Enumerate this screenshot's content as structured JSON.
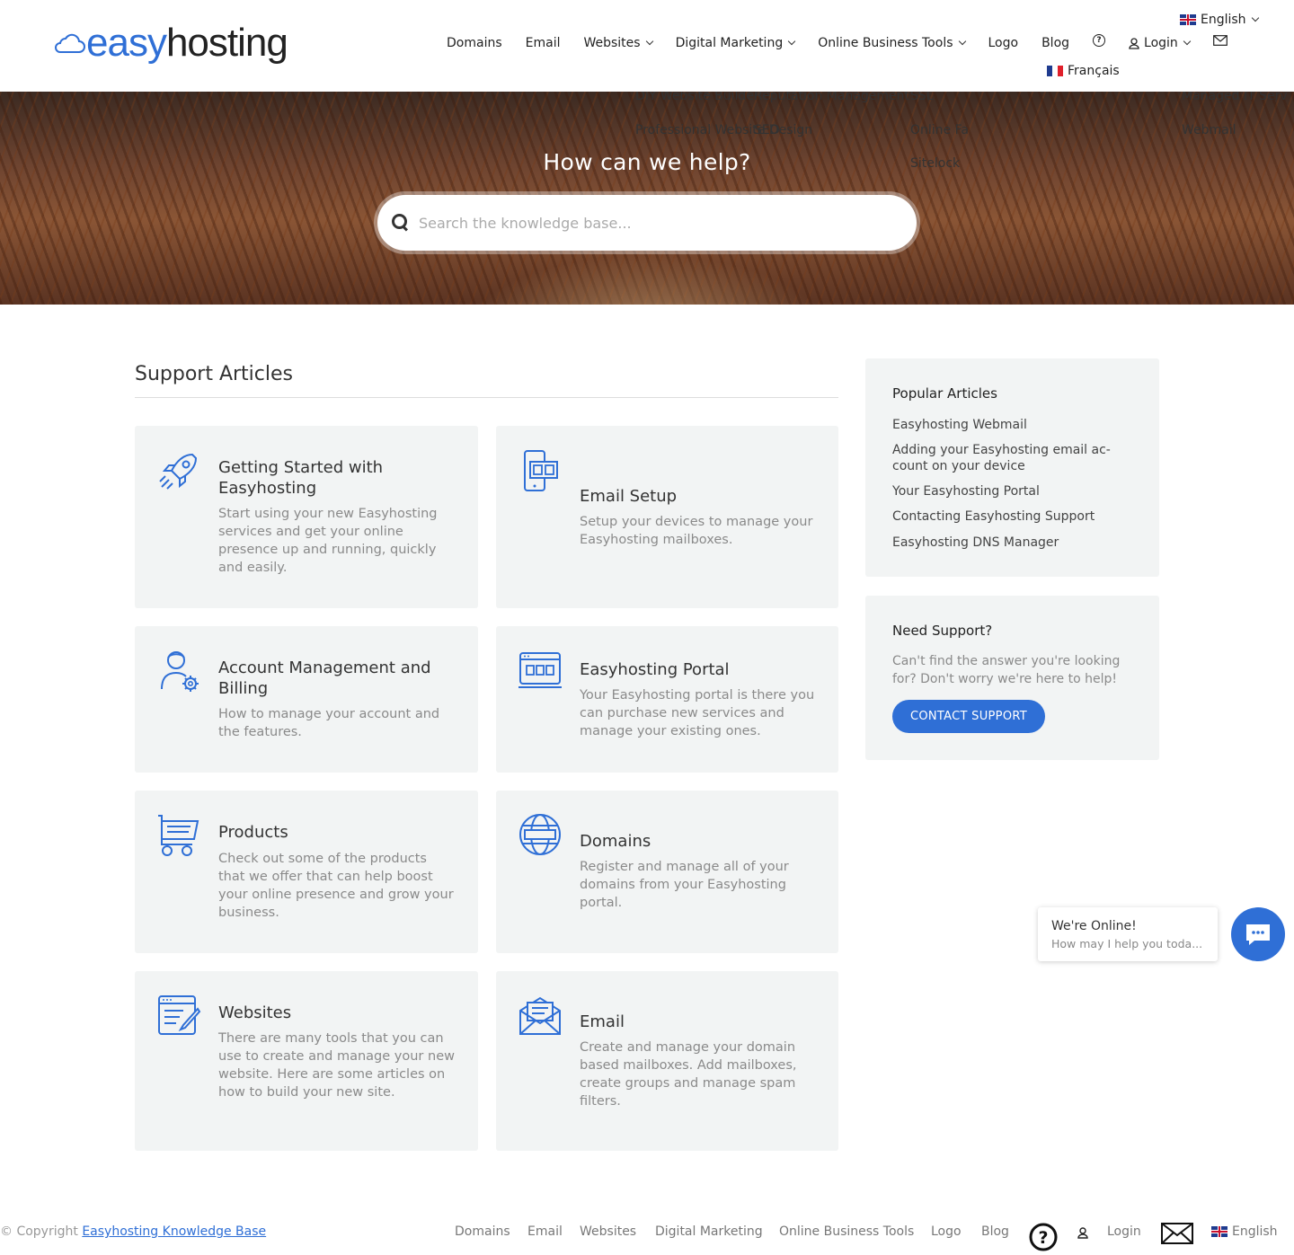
{
  "brand": {
    "logo_easy": "easy",
    "logo_hosting": "hosting",
    "accent_color": "#2f6fd6"
  },
  "nav": {
    "items": [
      "Domains",
      "Email",
      "Websites",
      "Digital Marketing",
      "Online Business Tools",
      "Logo",
      "Blog"
    ],
    "login": "Login",
    "lang_current": "English",
    "lang_alt": "Français"
  },
  "hero": {
    "title": "How can we help?",
    "search_placeholder": "Search the knowledge base...",
    "dropdown_ghost": {
      "diy": "DIY Website Builder",
      "pro": "Professional Website Design",
      "rep": "Reputation Management",
      "seo": "SEO",
      "ssl": "SSL",
      "online": "Online Fa",
      "sitelock": "Sitelock",
      "managed": "Managed IT Serv",
      "webmail": "Webmail"
    }
  },
  "main": {
    "section_title": "Support Articles",
    "cards": [
      {
        "title": "Getting Started with Easyhosting",
        "desc": "Start using your new Easyhosting services and get your online presence up and running, quickly and easily.",
        "icon": "rocket-icon"
      },
      {
        "title": "Email Setup",
        "desc": "Setup your devices to manage your Easyhosting mailboxes.",
        "icon": "devices-icon"
      },
      {
        "title": "Account Management and Billing",
        "desc": "How to manage your account and the features.",
        "icon": "user-gear-icon"
      },
      {
        "title": "Easyhosting Portal",
        "desc": "Your Easyhosting portal is there you can purchase new services and manage your existing ones.",
        "icon": "portal-icon"
      },
      {
        "title": "Products",
        "desc": "Check out some of the products that we offer that can help boost your online presence and grow your business.",
        "icon": "cart-icon"
      },
      {
        "title": "Domains",
        "desc": "Register and manage all of your domains from your Easyhosting portal.",
        "icon": "globe-icon"
      },
      {
        "title": "Websites",
        "desc": "There are many tools that you can use to create and manage your new website. Here are some articles on how to build your new site.",
        "icon": "edit-doc-icon"
      },
      {
        "title": "Email",
        "desc": "Create and manage your domain based mailboxes. Add mailboxes, create groups and manage spam filters.",
        "icon": "envelope-icon"
      }
    ]
  },
  "sidebar": {
    "popular_title": "Popular Articles",
    "popular": [
      "Easyhosting Webmail",
      "Adding your Easyhosting email ac­count on your device",
      "Your Easyhosting Portal",
      "Contacting Easyhosting Support",
      "Easyhosting DNS Manager"
    ],
    "support_title": "Need Support?",
    "support_text": "Can't find the answer you're looking for? Don't worry we're here to help!",
    "support_button": "CONTACT SUPPORT"
  },
  "chat": {
    "title": "We're Online!",
    "subtitle": "How may I help you toda..."
  },
  "footer": {
    "copyright_prefix": "© Copyright",
    "copyright_link": "Easyhosting Knowledge Base",
    "items": [
      "Domains",
      "Email",
      "Websites",
      "Digital Marketing",
      "Online Business Tools",
      "Logo",
      "Blog"
    ],
    "login": "Login",
    "lang": "English"
  }
}
